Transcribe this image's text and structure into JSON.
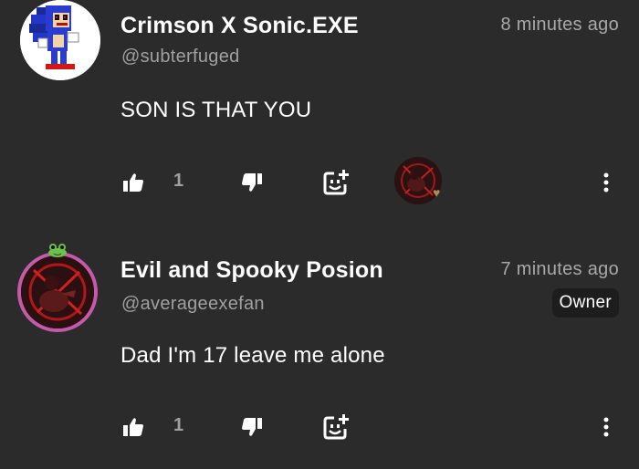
{
  "comments": [
    {
      "author": "Crimson X Sonic.EXE",
      "handle": "@subterfuged",
      "time": "8 minutes ago",
      "text": "SON IS THAT YOU",
      "likes": "1",
      "icons": {
        "avatar": "sonic-exe-avatar",
        "like": "thumbs-up-icon",
        "dislike": "thumbs-down-icon",
        "react": "add-reaction-icon",
        "more": "more-vertical-icon",
        "reaction_heart": "heart-icon"
      }
    },
    {
      "author": "Evil and Spooky Posion",
      "handle": "@averageexefan",
      "time": "7 minutes ago",
      "badge": "Owner",
      "text": "Dad I'm 17 leave me alone",
      "likes": "1",
      "icons": {
        "avatar": "dark-character-avatar",
        "avatar_decoration": "frog-icon",
        "like": "thumbs-up-icon",
        "dislike": "thumbs-down-icon",
        "react": "add-reaction-icon",
        "more": "more-vertical-icon"
      }
    }
  ],
  "colors": {
    "background": "#2b2b2b",
    "secondary_text": "#a0a0a0",
    "badge_bg": "#1d1d1d",
    "avatar_ring": "#c45aa8"
  }
}
